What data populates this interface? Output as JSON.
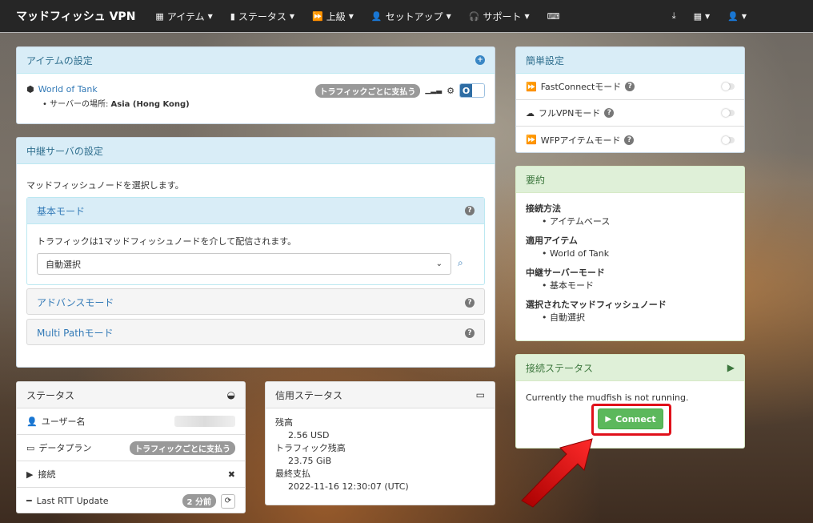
{
  "navbar": {
    "brand": "マッドフィッシュ VPN",
    "items": [
      {
        "icon": "grid-icon",
        "label": "アイテム"
      },
      {
        "icon": "bar-chart-icon",
        "label": "ステータス"
      },
      {
        "icon": "fast-forward-icon",
        "label": "上級"
      },
      {
        "icon": "user-icon",
        "label": "セットアップ"
      },
      {
        "icon": "headphones-icon",
        "label": "サポート"
      }
    ]
  },
  "item_settings": {
    "title": "アイテムの設定",
    "item_name": "World of Tank",
    "server_label": "サーバーの場所:",
    "server_value": "Asia (Hong Kong)",
    "badge": "トラフィックごとに支払う",
    "toggle": "O"
  },
  "relay_settings": {
    "title": "中継サーバの設定",
    "description": "マッドフィッシュノードを選択します。",
    "basic_mode": {
      "title": "基本モード",
      "text": "トラフィックは1マッドフィッシュノードを介して配信されます。",
      "select_value": "自動選択"
    },
    "advanced_mode": "アドバンスモード",
    "multipath_mode": "Multi Pathモード"
  },
  "status": {
    "title": "ステータス",
    "username_label": "ユーザー名",
    "dataplan_label": "データプラン",
    "dataplan_badge": "トラフィックごとに支払う",
    "connection_label": "接続",
    "connection_value": "✖",
    "rtt_label": "Last RTT Update",
    "rtt_badge": "2 分前"
  },
  "credit_status": {
    "title": "信用ステータス",
    "balance_label": "残高",
    "balance_value": "2.56 USD",
    "traffic_label": "トラフィック残高",
    "traffic_value": "23.75 GiB",
    "last_payment_label": "最終支払",
    "last_payment_value": "2022-11-16 12:30:07 (UTC)"
  },
  "quick_settings": {
    "title": "簡単設定",
    "rows": [
      {
        "icon": "fast-forward-icon",
        "label": "FastConnectモード"
      },
      {
        "icon": "cloud-icon",
        "label": "フルVPNモード"
      },
      {
        "icon": "fast-forward-icon",
        "label": "WFPアイテムモード"
      }
    ]
  },
  "summary": {
    "title": "要約",
    "connect_method_label": "接続方法",
    "connect_method_value": "アイテムベース",
    "applied_item_label": "適用アイテム",
    "applied_item_value": "World of Tank",
    "relay_mode_label": "中継サーバーモード",
    "relay_mode_value": "基本モード",
    "selected_node_label": "選択されたマッドフィッシュノード",
    "selected_node_value": "自動選択"
  },
  "connection_status": {
    "title": "接続ステータス",
    "message": "Currently the mudfish is not running.",
    "connect_button": "Connect"
  },
  "colors": {
    "navbar_bg": "#262626",
    "info_head": "#d9edf7",
    "success_head": "#dff0d8",
    "connect_green": "#5cb85c",
    "highlight_red": "#e0101a"
  }
}
